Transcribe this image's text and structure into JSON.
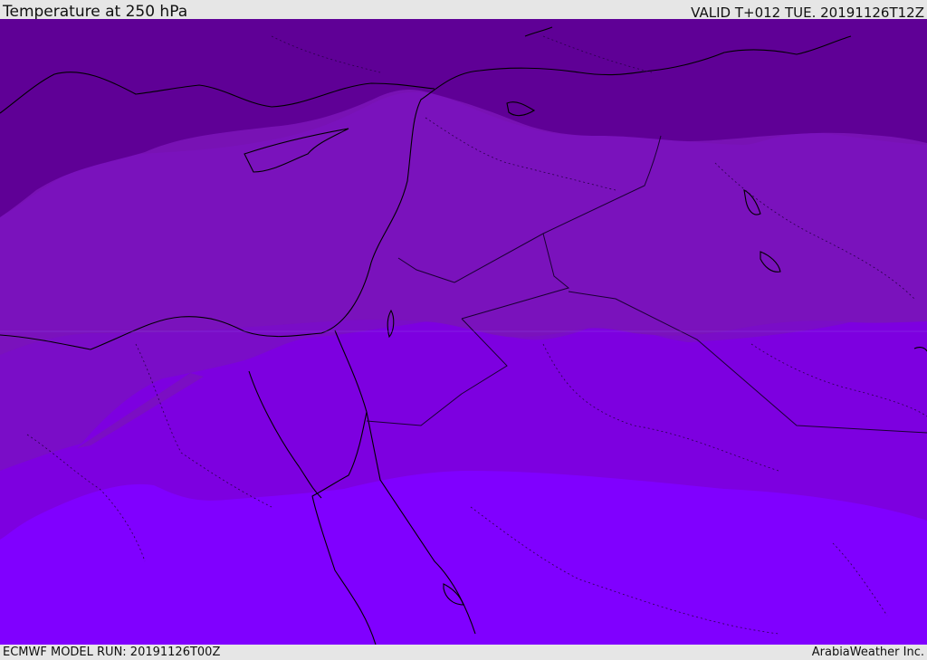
{
  "header": {
    "title": "Temperature at 250 hPa",
    "valid": "VALID T+012 TUE. 20191126T12Z"
  },
  "footer": {
    "model_run": "ECMWF MODEL RUN: 20191126T00Z",
    "provider": "ArabiaWeather Inc."
  },
  "map": {
    "colors": {
      "band_coldest": "#5f0096",
      "band_cold": "#7a12bc",
      "band_mid": "#7e00de",
      "band_warm": "#8000ff",
      "coast": "#000000",
      "border": "#1a0033"
    }
  }
}
